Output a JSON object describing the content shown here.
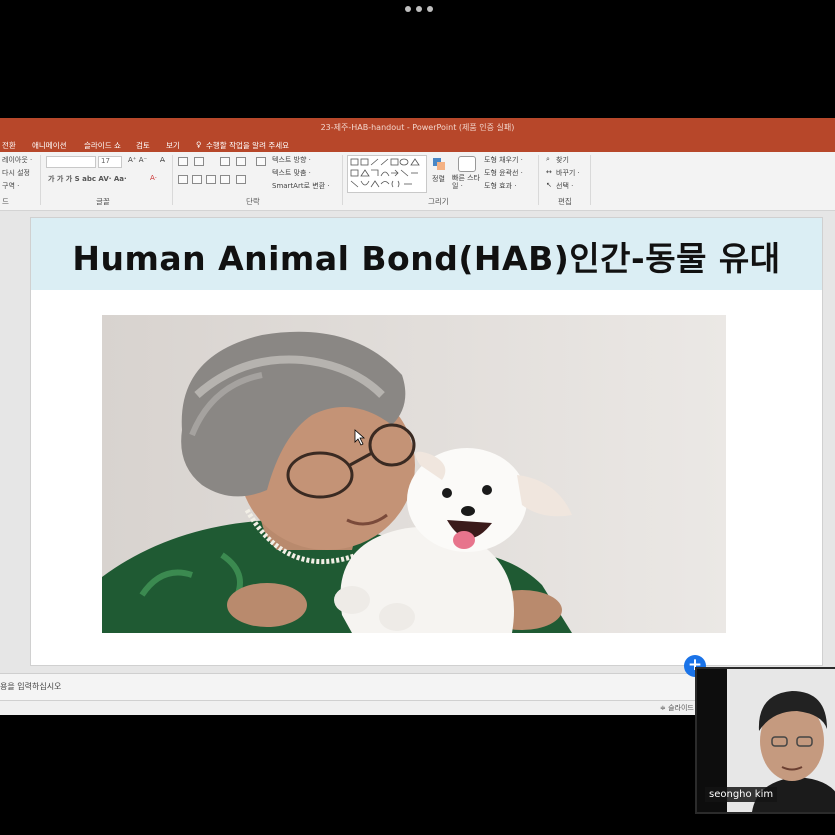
{
  "window_title": "23-제주-HAB-handout - PowerPoint (제품 인증 실패)",
  "menu": [
    "전환",
    "애니메이션",
    "슬라이드 쇼",
    "검토",
    "보기"
  ],
  "tell_me": "수행할 작업을 알려 주세요",
  "ribbon": {
    "layout_label": "레이아웃 ·",
    "reset_label": "다시 설정",
    "section_label": "구역 ·",
    "font_size": "17",
    "text_direction": "텍스트 방향 ·",
    "align_text": "텍스트 맞춤 ·",
    "smartart": "SmartArt로 변환 ·",
    "arrange": "정렬",
    "quick_styles": "빠른 스타일 ·",
    "shape_fill": "도형 채우기 ·",
    "shape_outline": "도형 윤곽선 ·",
    "shape_effects": "도형 효과 ·",
    "find": "찾기",
    "replace": "바꾸기 ·",
    "select": "선택 ·",
    "groups": {
      "slides_tail": "드",
      "font": "글꼴",
      "paragraph": "단락",
      "drawing": "그리기",
      "editing": "편집"
    }
  },
  "slide": {
    "title": "Human Animal Bond(HAB)인간-동물 유대"
  },
  "notes_placeholder": "용을 입력하십시오",
  "status_text": "슬라이드",
  "participant": {
    "name": "seongho kim"
  },
  "plus_label": "+"
}
